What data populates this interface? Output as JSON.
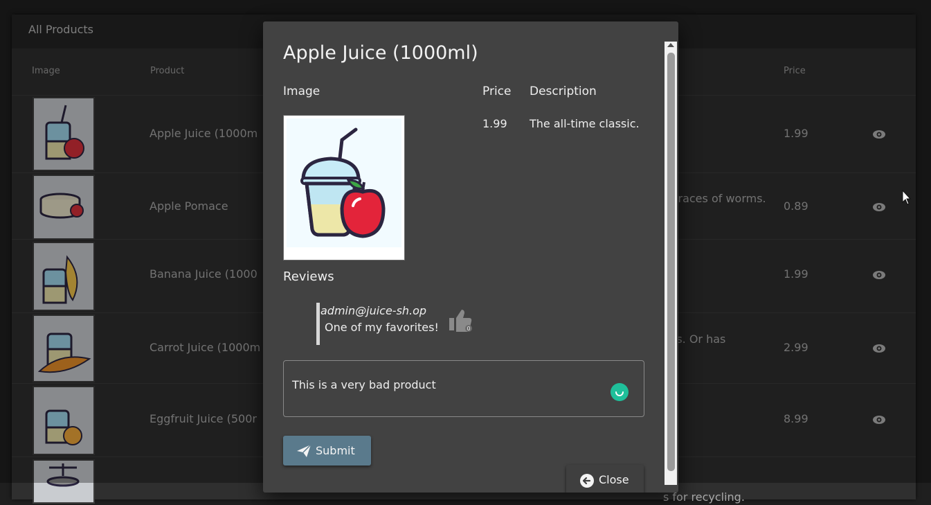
{
  "page": {
    "card_title": "All Products",
    "columns": {
      "image": "Image",
      "product": "Product",
      "price": "Price"
    },
    "rows": [
      {
        "name": "Apple Juice (1000m",
        "desc": "",
        "price": "1.99"
      },
      {
        "name": "Apple Pomace",
        "desc": "n traces of worms.",
        "price": "0.89"
      },
      {
        "name": "Banana Juice (1000",
        "desc": "",
        "price": "1.99"
      },
      {
        "name": "Carrot Juice (1000m",
        "desc": "yes. Or has",
        "price": "2.99"
      },
      {
        "name": "Eggfruit Juice (500r",
        "desc": "",
        "price": "8.99"
      },
      {
        "name": "",
        "desc": "s for recycling.",
        "price": ""
      }
    ],
    "view_icon": "eye-icon"
  },
  "dialog": {
    "title": "Apple Juice (1000ml)",
    "headers": {
      "image": "Image",
      "price": "Price",
      "description": "Description"
    },
    "price": "1.99",
    "description": "The all-time classic.",
    "reviews_heading": "Reviews",
    "review": {
      "author": "admin@juice-sh.op",
      "text": "One of my favorites!",
      "likes": "0"
    },
    "review_input_value": "This is a very bad product",
    "submit_label": "Submit",
    "close_label": "Close"
  },
  "icons": {
    "submit": "paper-plane-icon",
    "close": "arrow-left-circle-icon",
    "like": "thumbs-up-icon",
    "spinner": "loading-indicator-icon"
  },
  "colors": {
    "spinner": "#1fbf9a",
    "submit_button": "#5a7a8c"
  }
}
